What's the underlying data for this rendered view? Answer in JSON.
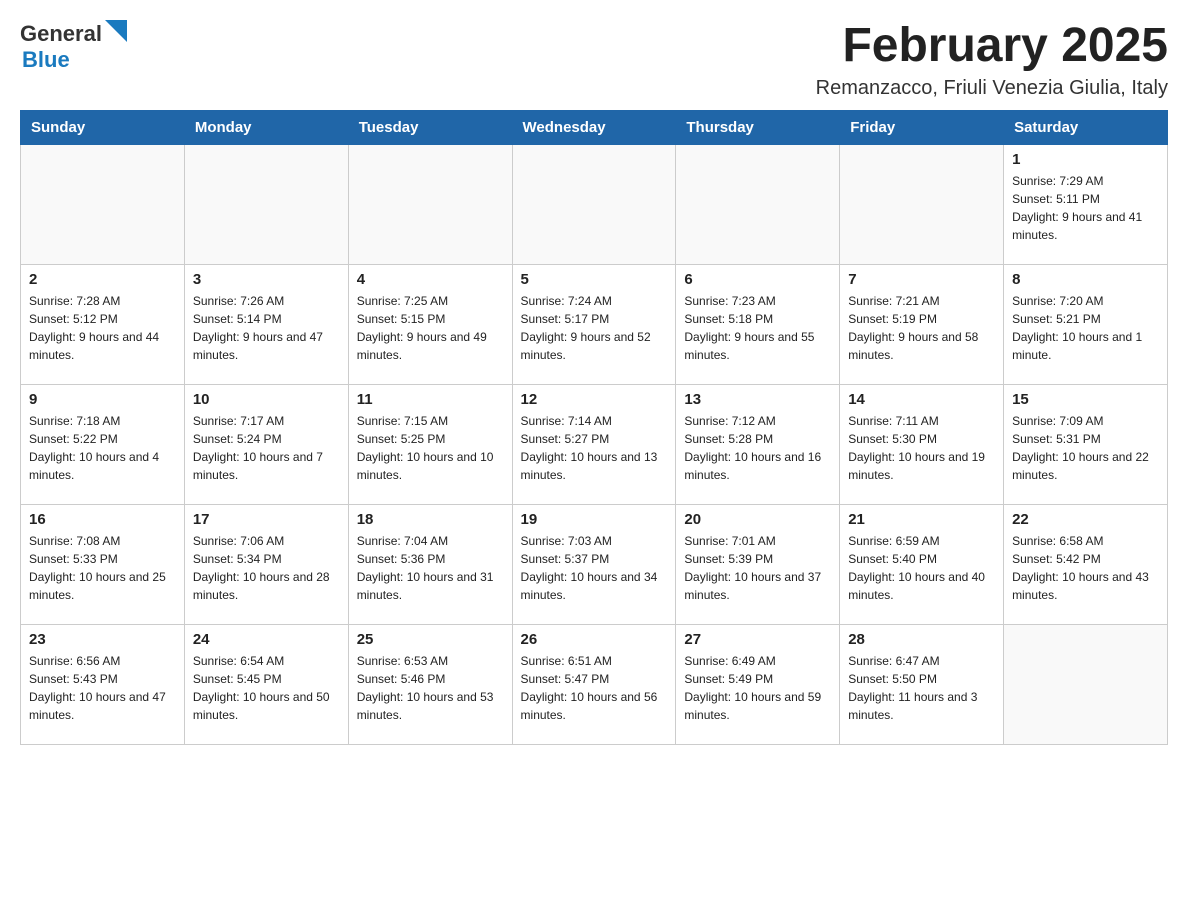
{
  "header": {
    "logo_general": "General",
    "logo_blue": "Blue",
    "month_title": "February 2025",
    "location": "Remanzacco, Friuli Venezia Giulia, Italy"
  },
  "weekdays": [
    "Sunday",
    "Monday",
    "Tuesday",
    "Wednesday",
    "Thursday",
    "Friday",
    "Saturday"
  ],
  "weeks": [
    [
      {
        "day": "",
        "info": ""
      },
      {
        "day": "",
        "info": ""
      },
      {
        "day": "",
        "info": ""
      },
      {
        "day": "",
        "info": ""
      },
      {
        "day": "",
        "info": ""
      },
      {
        "day": "",
        "info": ""
      },
      {
        "day": "1",
        "info": "Sunrise: 7:29 AM\nSunset: 5:11 PM\nDaylight: 9 hours and 41 minutes."
      }
    ],
    [
      {
        "day": "2",
        "info": "Sunrise: 7:28 AM\nSunset: 5:12 PM\nDaylight: 9 hours and 44 minutes."
      },
      {
        "day": "3",
        "info": "Sunrise: 7:26 AM\nSunset: 5:14 PM\nDaylight: 9 hours and 47 minutes."
      },
      {
        "day": "4",
        "info": "Sunrise: 7:25 AM\nSunset: 5:15 PM\nDaylight: 9 hours and 49 minutes."
      },
      {
        "day": "5",
        "info": "Sunrise: 7:24 AM\nSunset: 5:17 PM\nDaylight: 9 hours and 52 minutes."
      },
      {
        "day": "6",
        "info": "Sunrise: 7:23 AM\nSunset: 5:18 PM\nDaylight: 9 hours and 55 minutes."
      },
      {
        "day": "7",
        "info": "Sunrise: 7:21 AM\nSunset: 5:19 PM\nDaylight: 9 hours and 58 minutes."
      },
      {
        "day": "8",
        "info": "Sunrise: 7:20 AM\nSunset: 5:21 PM\nDaylight: 10 hours and 1 minute."
      }
    ],
    [
      {
        "day": "9",
        "info": "Sunrise: 7:18 AM\nSunset: 5:22 PM\nDaylight: 10 hours and 4 minutes."
      },
      {
        "day": "10",
        "info": "Sunrise: 7:17 AM\nSunset: 5:24 PM\nDaylight: 10 hours and 7 minutes."
      },
      {
        "day": "11",
        "info": "Sunrise: 7:15 AM\nSunset: 5:25 PM\nDaylight: 10 hours and 10 minutes."
      },
      {
        "day": "12",
        "info": "Sunrise: 7:14 AM\nSunset: 5:27 PM\nDaylight: 10 hours and 13 minutes."
      },
      {
        "day": "13",
        "info": "Sunrise: 7:12 AM\nSunset: 5:28 PM\nDaylight: 10 hours and 16 minutes."
      },
      {
        "day": "14",
        "info": "Sunrise: 7:11 AM\nSunset: 5:30 PM\nDaylight: 10 hours and 19 minutes."
      },
      {
        "day": "15",
        "info": "Sunrise: 7:09 AM\nSunset: 5:31 PM\nDaylight: 10 hours and 22 minutes."
      }
    ],
    [
      {
        "day": "16",
        "info": "Sunrise: 7:08 AM\nSunset: 5:33 PM\nDaylight: 10 hours and 25 minutes."
      },
      {
        "day": "17",
        "info": "Sunrise: 7:06 AM\nSunset: 5:34 PM\nDaylight: 10 hours and 28 minutes."
      },
      {
        "day": "18",
        "info": "Sunrise: 7:04 AM\nSunset: 5:36 PM\nDaylight: 10 hours and 31 minutes."
      },
      {
        "day": "19",
        "info": "Sunrise: 7:03 AM\nSunset: 5:37 PM\nDaylight: 10 hours and 34 minutes."
      },
      {
        "day": "20",
        "info": "Sunrise: 7:01 AM\nSunset: 5:39 PM\nDaylight: 10 hours and 37 minutes."
      },
      {
        "day": "21",
        "info": "Sunrise: 6:59 AM\nSunset: 5:40 PM\nDaylight: 10 hours and 40 minutes."
      },
      {
        "day": "22",
        "info": "Sunrise: 6:58 AM\nSunset: 5:42 PM\nDaylight: 10 hours and 43 minutes."
      }
    ],
    [
      {
        "day": "23",
        "info": "Sunrise: 6:56 AM\nSunset: 5:43 PM\nDaylight: 10 hours and 47 minutes."
      },
      {
        "day": "24",
        "info": "Sunrise: 6:54 AM\nSunset: 5:45 PM\nDaylight: 10 hours and 50 minutes."
      },
      {
        "day": "25",
        "info": "Sunrise: 6:53 AM\nSunset: 5:46 PM\nDaylight: 10 hours and 53 minutes."
      },
      {
        "day": "26",
        "info": "Sunrise: 6:51 AM\nSunset: 5:47 PM\nDaylight: 10 hours and 56 minutes."
      },
      {
        "day": "27",
        "info": "Sunrise: 6:49 AM\nSunset: 5:49 PM\nDaylight: 10 hours and 59 minutes."
      },
      {
        "day": "28",
        "info": "Sunrise: 6:47 AM\nSunset: 5:50 PM\nDaylight: 11 hours and 3 minutes."
      },
      {
        "day": "",
        "info": ""
      }
    ]
  ]
}
